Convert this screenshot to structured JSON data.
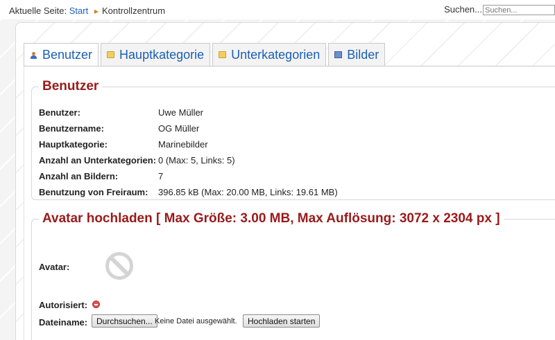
{
  "breadcrumb": {
    "prefix": "Aktuelle Seite:",
    "home": "Start",
    "current": "Kontrollzentrum"
  },
  "search": {
    "label": "Suchen...",
    "placeholder": "Suchen..."
  },
  "tabs": [
    {
      "label": "Benutzer",
      "icon": "user-icon",
      "active": true
    },
    {
      "label": "Hauptkategorie",
      "icon": "folder-icon",
      "active": false
    },
    {
      "label": "Unterkategorien",
      "icon": "folder-icon",
      "active": false
    },
    {
      "label": "Bilder",
      "icon": "image-icon",
      "active": false
    }
  ],
  "user_section": {
    "legend": "Benutzer",
    "rows": [
      {
        "label": "Benutzer:",
        "value": "Uwe Müller"
      },
      {
        "label": "Benutzername:",
        "value": "OG Müller"
      },
      {
        "label": "Hauptkategorie:",
        "value": "Marinebilder"
      },
      {
        "label": "Anzahl an Unterkategorien:",
        "value": "0 (Max: 5, Links: 5)"
      },
      {
        "label": "Anzahl an Bildern:",
        "value": "7"
      },
      {
        "label": "Benutzung von Freiraum:",
        "value": "396.85 kB (Max: 20.00 MB, Links: 19.61 MB)"
      }
    ]
  },
  "avatar_section": {
    "legend": "Avatar hochladen [ Max Größe: 3.00 MB, Max Auflösung: 3072 x 2304 px ]",
    "avatar_label": "Avatar:",
    "authorized_label": "Autorisiert:",
    "authorized_icon": "not-authorized-icon",
    "filename_label": "Dateiname:",
    "browse_button": "Durchsuchen...",
    "no_file_text": "Keine Datei ausgewählt.",
    "upload_button": "Hochladen starten"
  },
  "colors": {
    "link": "#1a5fb4",
    "legend": "#9a1a1a",
    "status_negative": "#d9534f"
  }
}
